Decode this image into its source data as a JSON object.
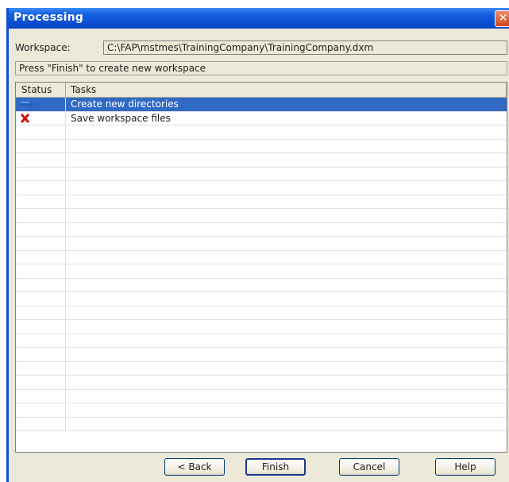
{
  "window": {
    "title": "Processing",
    "close_label": "✕"
  },
  "workspace": {
    "label": "Workspace:",
    "value": "C:\\FAP\\mstmes\\TrainingCompany\\TrainingCompany.dxm"
  },
  "hint": "Press \"Finish\" to create new workspace",
  "table": {
    "headers": {
      "status": "Status",
      "tasks": "Tasks"
    },
    "rows": [
      {
        "status_icon": "arrow-right-icon",
        "task": "Create new directories",
        "selected": true
      },
      {
        "status_icon": "red-x-icon",
        "task": "Save workspace files",
        "selected": false
      }
    ],
    "empty_rows": 22
  },
  "buttons": {
    "back": "< Back",
    "finish": "Finish",
    "cancel": "Cancel",
    "help": "Help"
  },
  "colors": {
    "titlebar": "#0a4fd4",
    "selection": "#316ac5",
    "error": "#cc1010"
  }
}
